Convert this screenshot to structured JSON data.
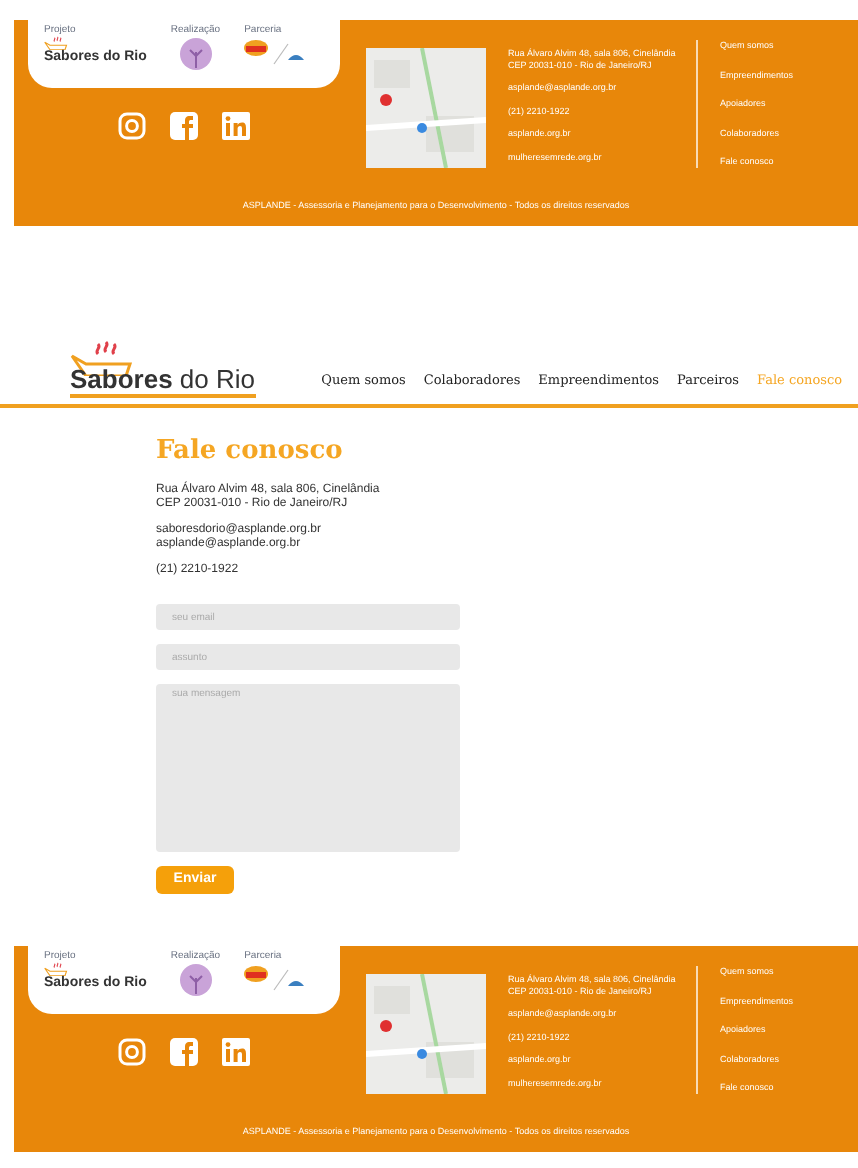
{
  "footers": [
    {
      "logo_labels": [
        "Projeto",
        "Realização",
        "Parceria"
      ],
      "brand": "Sabores do Rio",
      "contact": [
        "Rua Álvaro Alvim 48, sala 806, Cinelândia",
        "CEP 20031-010 - Rio de Janeiro/RJ",
        "asplande@asplande.org.br",
        "(21) 2210-1922",
        "asplande.org.br",
        "mulheresemrede.org.br"
      ],
      "links": [
        "Quem somos",
        "Empreendimentos",
        "Apoiadores",
        "Colaboradores",
        "Fale conosco"
      ],
      "copyright": "ASPLANDE - Assessoria e Planejamento para o Desenvolvimento - Todos os direitos reservados"
    },
    {
      "logo_labels": [
        "Projeto",
        "Realização",
        "Parceria"
      ],
      "brand": "Sabores do Rio",
      "contact": [
        "Rua Álvaro Alvim 48, sala 806, Cinelândia",
        "CEP 20031-010 - Rio de Janeiro/RJ",
        "asplande@asplande.org.br",
        "(21) 2210-1922",
        "asplande.org.br",
        "mulheresemrede.org.br"
      ],
      "links": [
        "Quem somos",
        "Empreendimentos",
        "Apoiadores",
        "Colaboradores",
        "Fale conosco"
      ],
      "copyright": "ASPLANDE - Assessoria e Planejamento para o Desenvolvimento - Todos os direitos reservados"
    }
  ],
  "header": {
    "brand": "**Sabores** do Rio",
    "nav": [
      {
        "label": "Quem somos",
        "selected": false
      },
      {
        "label": "Colaboradores",
        "selected": false
      },
      {
        "label": "Empreendimentos",
        "selected": false
      },
      {
        "label": "Parceiros",
        "selected": false
      },
      {
        "label": "Fale conosco",
        "selected": true
      }
    ]
  },
  "contact": {
    "title": "Fale conosco",
    "address": [
      "Rua Álvaro Alvim 48, sala 806, Cinelândia",
      "CEP 20031-010 - Rio de Janeiro/RJ"
    ],
    "emails": [
      "saboresdorio@asplande.org.br",
      "asplande@asplande.org.br"
    ],
    "phone": "(21) 2210-1922",
    "form": {
      "email_placeholder": "seu email",
      "subject_placeholder": "assunto",
      "message_placeholder": "sua mensagem",
      "submit": "Enviar"
    }
  }
}
